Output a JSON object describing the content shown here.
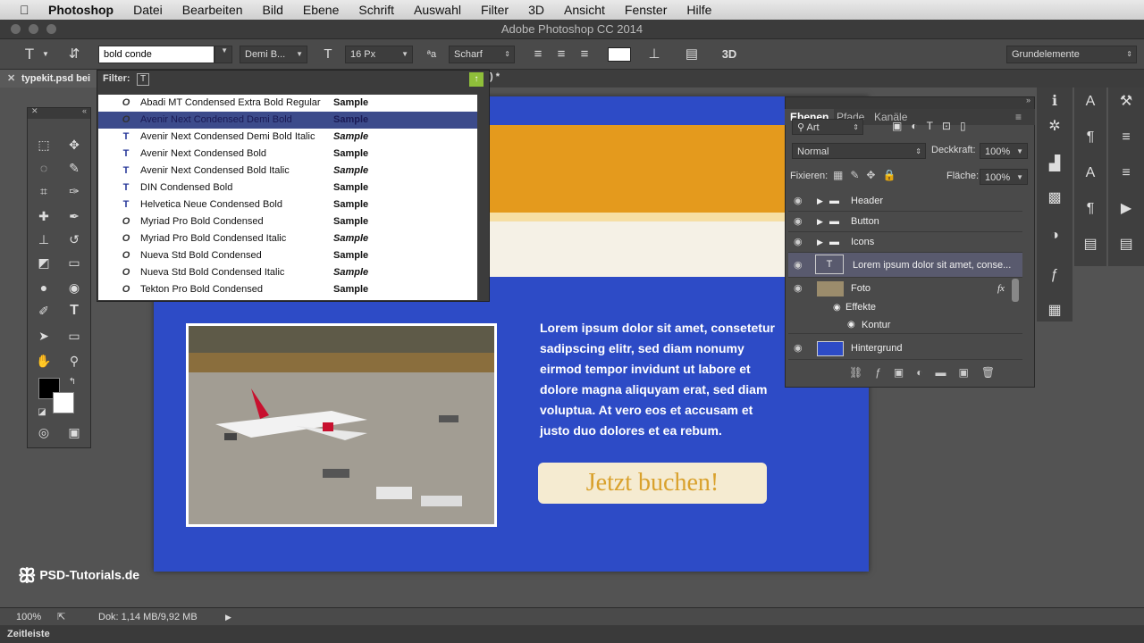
{
  "menubar": {
    "app": "Photoshop",
    "items": [
      "Datei",
      "Bearbeiten",
      "Bild",
      "Ebene",
      "Schrift",
      "Auswahl",
      "Filter",
      "3D",
      "Ansicht",
      "Fenster",
      "Hilfe"
    ]
  },
  "window": {
    "title": "Adobe Photoshop CC 2014"
  },
  "options": {
    "font_search_value": "bold conde",
    "font_style": "Demi B...",
    "font_size": "16 Px",
    "antialias": "Scharf",
    "workspace": "Grundelemente",
    "three_d": "3D",
    "filter_label": "Filter:"
  },
  "document_tab": {
    "name": "typekit.psd bei",
    "suffix": ") *"
  },
  "font_list": [
    {
      "icon": "O",
      "name": "Abadi MT Condensed Extra Bold Regular",
      "sample": "Sample",
      "selected": false
    },
    {
      "icon": "O",
      "name": "Avenir Next Condensed Demi Bold",
      "sample": "Sample",
      "selected": true
    },
    {
      "icon": "T",
      "name": "Avenir Next Condensed Demi Bold Italic",
      "sample": "Sample",
      "selected": false
    },
    {
      "icon": "T",
      "name": "Avenir Next Condensed Bold",
      "sample": "Sample",
      "selected": false
    },
    {
      "icon": "T",
      "name": "Avenir Next Condensed Bold Italic",
      "sample": "Sample",
      "selected": false
    },
    {
      "icon": "T",
      "name": "DIN Condensed Bold",
      "sample": "Sample",
      "selected": false
    },
    {
      "icon": "T",
      "name": "Helvetica Neue Condensed Bold",
      "sample": "Sample",
      "selected": false
    },
    {
      "icon": "O",
      "name": "Myriad Pro Bold Condensed",
      "sample": "Sample",
      "selected": false
    },
    {
      "icon": "O",
      "name": "Myriad Pro Bold Condensed Italic",
      "sample": "Sample",
      "selected": false
    },
    {
      "icon": "O",
      "name": "Nueva Std Bold Condensed",
      "sample": "Sample",
      "selected": false
    },
    {
      "icon": "O",
      "name": "Nueva Std Bold Condensed Italic",
      "sample": "Sample",
      "selected": false
    },
    {
      "icon": "O",
      "name": "Tekton Pro Bold Condensed",
      "sample": "Sample",
      "selected": false
    }
  ],
  "canvas": {
    "body_text": "Lorem ipsum dolor sit amet, consetetur sadipscing elitr, sed diam nonumy eirmod tempor invidunt ut labore et dolore magna aliquyam erat, sed diam voluptua. At vero eos et accusam et justo duo dolores et ea rebum.",
    "cta_label": "Jetzt buchen!",
    "blue": "#2d4bc6",
    "orange": "#e49a1d"
  },
  "layers_panel": {
    "tabs": [
      "Ebenen",
      "Pfade",
      "Kanäle"
    ],
    "kind_filter": "Art",
    "blend_mode": "Normal",
    "opacity_label": "Deckkraft:",
    "opacity_value": "100%",
    "lock_label": "Fixieren:",
    "fill_label": "Fläche:",
    "fill_value": "100%",
    "layers": [
      {
        "name": "Header",
        "type": "group"
      },
      {
        "name": "Button",
        "type": "group"
      },
      {
        "name": "Icons",
        "type": "group"
      },
      {
        "name": "Lorem ipsum dolor sit amet, conse...",
        "type": "text",
        "selected": true
      },
      {
        "name": "Foto",
        "type": "image",
        "fx": "fx"
      },
      {
        "name": "Effekte",
        "type": "effects"
      },
      {
        "name": "Kontur",
        "type": "effect"
      },
      {
        "name": "Hintergrund",
        "type": "fill"
      }
    ]
  },
  "status": {
    "zoom": "100%",
    "doc_info": "Dok: 1,14 MB/9,92 MB",
    "timeline": "Zeitleiste"
  },
  "watermark": "PSD-Tutorials.de"
}
